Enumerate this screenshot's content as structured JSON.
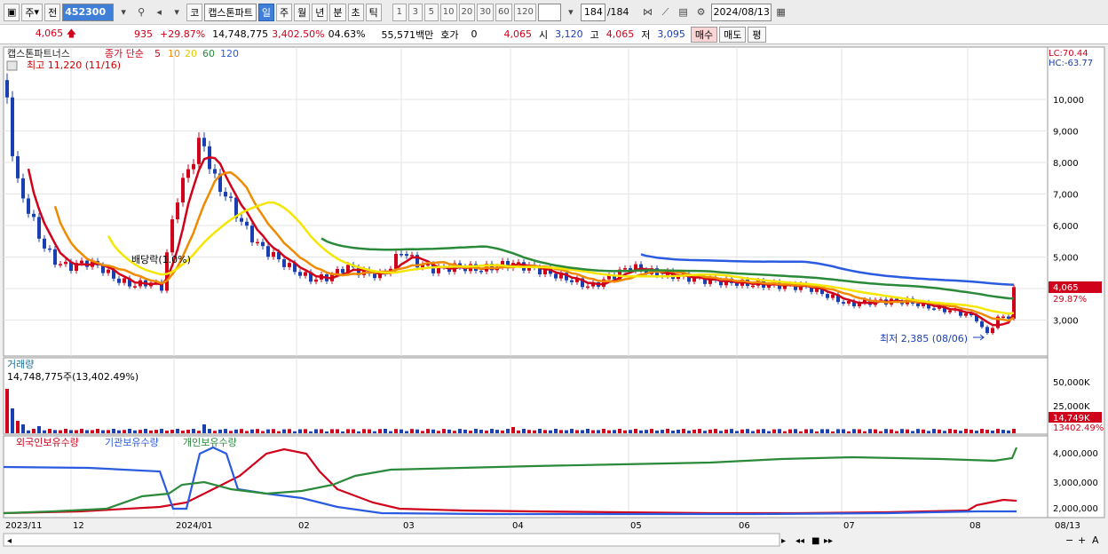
{
  "toolbar": {
    "market_type": "주",
    "period_type": "전",
    "stock_code": "452300",
    "market_label": "코",
    "stock_name": "캡스톤파트",
    "periods": [
      "일",
      "주",
      "월",
      "년",
      "분",
      "초",
      "틱"
    ],
    "active_period": "일",
    "minute_options": [
      "1",
      "3",
      "5",
      "10",
      "20",
      "30",
      "60",
      "120"
    ],
    "bar_count": "184",
    "bar_total": "/184",
    "date": "2024/08/13"
  },
  "quote": {
    "price": "4,065",
    "change": "935",
    "change_pct": "+29.87%",
    "volume": "14,748,775",
    "volume_ratio": "3,402.50%",
    "turnover": "04.63%",
    "amount": "55,571백만",
    "hoga_label": "호가",
    "hoga_value": "0",
    "current": "4,065",
    "open_label": "시",
    "open": "3,120",
    "high_label": "고",
    "high": "4,065",
    "low_label": "저",
    "low": "3,095",
    "buy_label": "매수",
    "sell_label": "매도",
    "eval_label": "평"
  },
  "price_panel": {
    "legend_name": "캡스톤파트너스",
    "legend_ma": "종가 단순",
    "ma_periods": [
      "5",
      "10",
      "20",
      "60",
      "120"
    ],
    "ma_colors": [
      "#d0021b",
      "#f08a00",
      "#f5e600",
      "#2a8a3a",
      "#2a5be0"
    ],
    "high_note": "최고 11,220 (11/16)",
    "low_note": "최저 2,385 (08/06)",
    "dividend_note": "배당락(1.0%)",
    "lc": "LC:70.44",
    "hc": "HC:-63.77",
    "y_ticks": [
      "10,000",
      "9,000",
      "8,000",
      "7,000",
      "6,000",
      "5,000",
      "4,000",
      "3,000"
    ],
    "tick_values": [
      10000,
      9000,
      8000,
      7000,
      6000,
      5000,
      4000,
      3000
    ],
    "cur_price": "4,065",
    "cur_pct": "29.87%"
  },
  "volume_panel": {
    "title": "거래량",
    "value_label": "14,748,775주(13,402.49%)",
    "y_ticks": [
      "50,000K",
      "25,000K"
    ],
    "cur_volume": "14,749K",
    "cur_pct": "13402.49%"
  },
  "holding_panel": {
    "legend": [
      "외국인보유수량",
      "기관보유수량",
      "개인보유수량"
    ],
    "legend_colors": [
      "#d0021b",
      "#2a5be0",
      "#2a8a3a"
    ],
    "y_ticks": [
      "4,000,000",
      "3,000,000",
      "2,000,000"
    ]
  },
  "x_axis": {
    "labels": [
      "2023/11",
      "12",
      "2024/01",
      "02",
      "03",
      "04",
      "05",
      "06",
      "07",
      "08",
      "08/13"
    ]
  },
  "chart_data": {
    "type": "line",
    "y_range": [
      2200,
      11500
    ],
    "candles": [
      {
        "date": "2023-11-16",
        "price": 11220
      },
      {
        "date": "2024-01-19",
        "price": 8800
      },
      {
        "date": "2024-02-15",
        "price": 4300
      },
      {
        "date": "2024-03-05",
        "price": 4800
      },
      {
        "date": "2024-04-01",
        "price": 4700
      },
      {
        "date": "2024-05-02",
        "price": 4500
      },
      {
        "date": "2024-06-03",
        "price": 4100
      },
      {
        "date": "2024-07-01",
        "price": 3600
      },
      {
        "date": "2024-08-06",
        "price": 2385
      },
      {
        "date": "2024-08-13",
        "price": 4065
      }
    ]
  }
}
